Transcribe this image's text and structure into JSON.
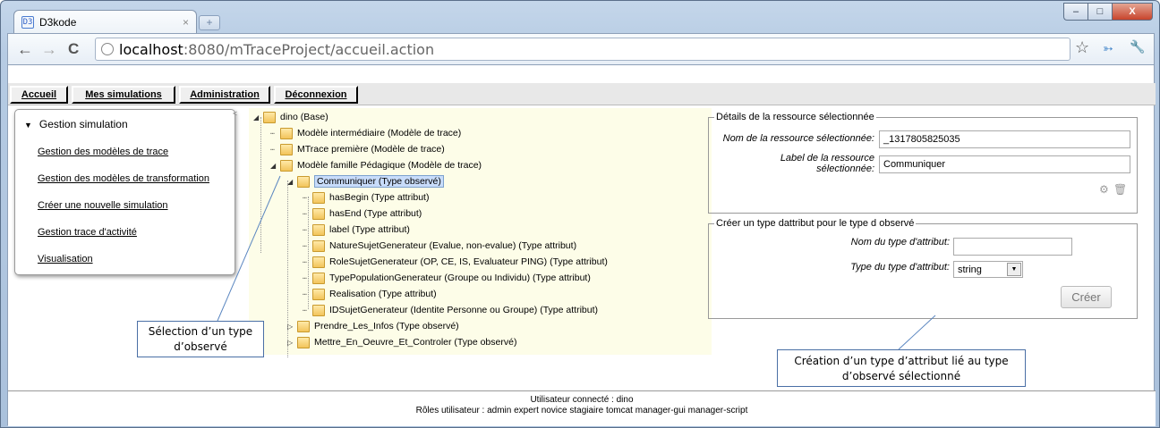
{
  "browser": {
    "tab_title": "D3kode",
    "tab_close": "×",
    "new_tab": "+",
    "favicon_text": "D3",
    "url_host": "localhost",
    "url_rest": ":8080/mTraceProject/accueil.action",
    "back": "←",
    "forward": "→",
    "reload": "C",
    "star": "☆",
    "wrench": "🔧",
    "minimize": "–",
    "maximize": "□",
    "close": "X"
  },
  "menu": {
    "items": [
      {
        "label": "Accueil"
      },
      {
        "label": "Mes simulations"
      },
      {
        "label": "Administration"
      },
      {
        "label": "Déconnexion"
      }
    ]
  },
  "sidebar": {
    "header": "Gestion simulation",
    "links": [
      {
        "label": "Gestion des modèles de trace"
      },
      {
        "label": "Gestion des modèles de transformation"
      },
      {
        "label": "Créer une nouvelle simulation"
      },
      {
        "label": "Gestion trace d'activité"
      },
      {
        "label": "Visualisation"
      }
    ]
  },
  "tree": {
    "nodes": [
      {
        "label": "dino (Base)"
      },
      {
        "label": "Modèle intermédiaire (Modèle de trace)"
      },
      {
        "label": "MTrace première (Modèle de trace)"
      },
      {
        "label": "Modèle famille Pédagique (Modèle de trace)"
      },
      {
        "label": "Communiquer (Type observé)"
      },
      {
        "label": "hasBegin (Type attribut)"
      },
      {
        "label": "hasEnd (Type attribut)"
      },
      {
        "label": "label (Type attribut)"
      },
      {
        "label": "NatureSujetGenerateur (Evalue, non-evalue) (Type attribut)"
      },
      {
        "label": "RoleSujetGenerateur (OP, CE, IS, Evaluateur PING) (Type attribut)"
      },
      {
        "label": "TypePopulationGenerateur (Groupe ou Individu) (Type attribut)"
      },
      {
        "label": "Realisation (Type attribut)"
      },
      {
        "label": "IDSujetGenerateur (Identite Personne ou Groupe) (Type attribut)"
      },
      {
        "label": "Prendre_Les_Infos (Type observé)"
      },
      {
        "label": "Mettre_En_Oeuvre_Et_Controler (Type observé)"
      }
    ]
  },
  "details": {
    "legend": "Détails de la ressource sélectionnée",
    "name_label": "Nom de la ressource sélectionnée:",
    "name_value": "_1317805825035",
    "label_label_1": "Label de la ressource",
    "label_label_2": "sélectionnée:",
    "label_value": "Communiquer"
  },
  "create": {
    "legend": "Créer un type dattribut pour le type d observé",
    "name_label": "Nom du type d'attribut:",
    "name_value": "",
    "type_label": "Type du type d'attribut:",
    "type_value": "string",
    "button": "Créer"
  },
  "callouts": {
    "selection": "Sélection d’un type d’observé",
    "creation_1": "Création d’un type d’attribut lié au type",
    "creation_2": "d’observé sélectionné"
  },
  "footer": {
    "line1": "Utilisateur connecté : dino",
    "line2": "Rôles utilisateur : admin expert novice stagiaire tomcat manager-gui manager-script"
  }
}
